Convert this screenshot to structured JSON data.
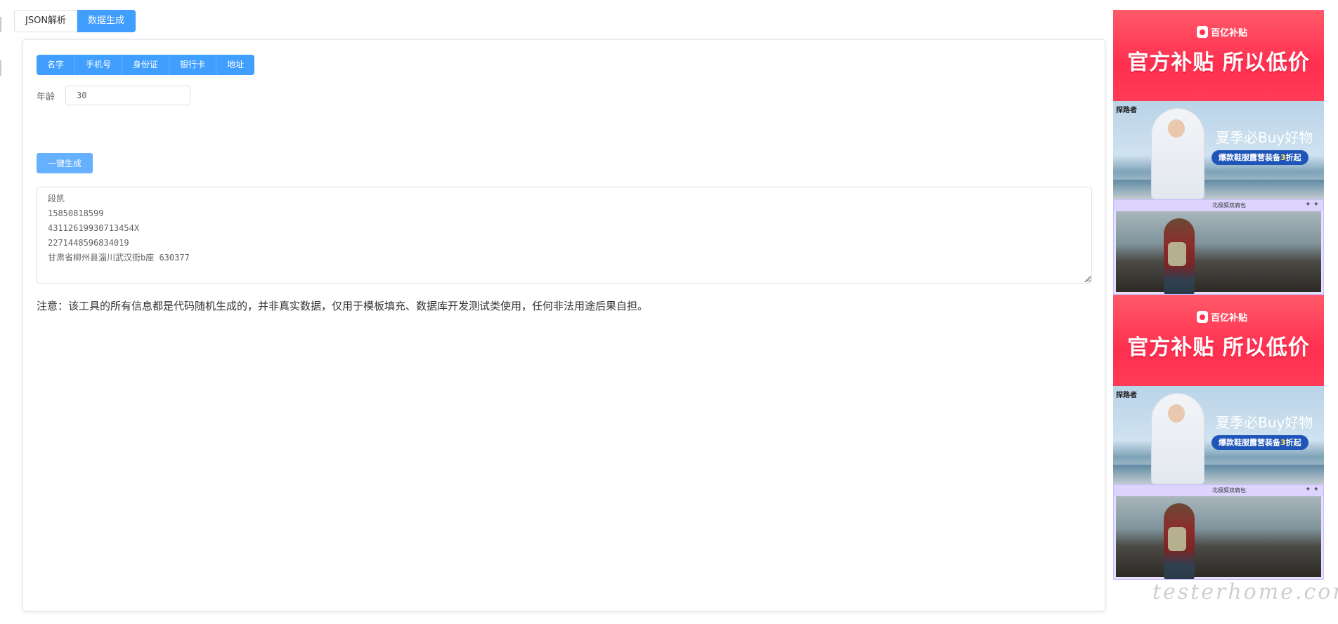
{
  "top_tabs": [
    {
      "label": "JSON解析",
      "active": false
    },
    {
      "label": "数据生成",
      "active": true
    }
  ],
  "generator": {
    "tabs": [
      {
        "label": "名字"
      },
      {
        "label": "手机号"
      },
      {
        "label": "身份证"
      },
      {
        "label": "银行卡"
      },
      {
        "label": "地址"
      }
    ],
    "age_label": "年龄",
    "age_value": "30",
    "generate_label": "一键生成",
    "result_text": "段凯\n15850818599\n43112619930713454X\n2271448596834019\n甘肃省柳州县淄川武汉街b座 630377",
    "notice": "注意：该工具的所有信息都是代码随机生成的，并非真实数据，仅用于模板填充、数据库开发测试类使用，任何非法用途后果自担。"
  },
  "ads": [
    {
      "type": "red",
      "badge": "百亿补贴",
      "headline": "官方补贴 所以低价"
    },
    {
      "type": "summer",
      "brand": "探路者",
      "headline": "夏季必Buy好物",
      "pill_prefix": "爆款鞋服露营装备",
      "pill_highlight": "3",
      "pill_suffix": "折起"
    },
    {
      "type": "rock",
      "caption": "北极狐双肩包",
      "sparkle": "✦ ✦"
    },
    {
      "type": "red",
      "badge": "百亿补贴",
      "headline": "官方补贴 所以低价"
    },
    {
      "type": "summer",
      "brand": "探路者",
      "headline": "夏季必Buy好物",
      "pill_prefix": "爆款鞋服露营装备",
      "pill_highlight": "3",
      "pill_suffix": "折起"
    },
    {
      "type": "rock",
      "caption": "北极狐双肩包",
      "sparkle": "✦ ✦"
    }
  ],
  "watermark": "testerhome.com",
  "colors": {
    "primary": "#409eff",
    "primary_light": "#66b1ff",
    "ad_red": "#ff2f4f",
    "ad_blue_pill": "#1f55b8"
  }
}
